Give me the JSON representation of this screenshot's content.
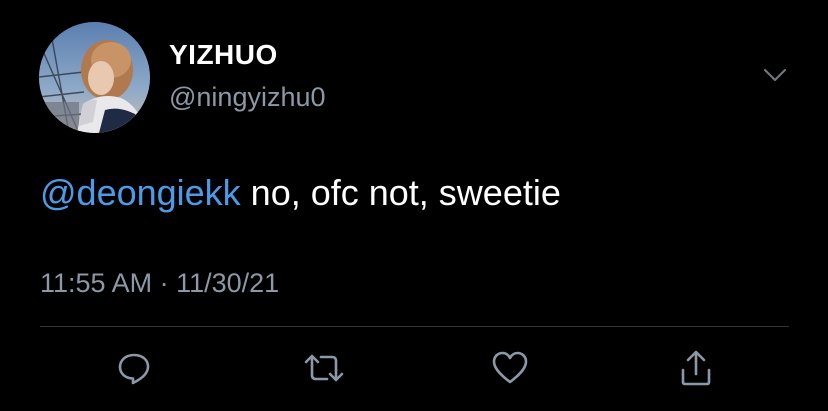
{
  "tweet": {
    "author": {
      "display_name": "YIZHUO",
      "handle": "@ningyizhu0",
      "avatar_icon": "profile-photo"
    },
    "text": {
      "mention": "@deongiekk",
      "body": " no, ofc not, sweetie"
    },
    "timestamp": "11:55 AM · 11/30/21",
    "actions": [
      {
        "name": "reply",
        "icon": "speech-bubble-icon"
      },
      {
        "name": "retweet",
        "icon": "retweet-arrows-icon"
      },
      {
        "name": "like",
        "icon": "heart-icon"
      },
      {
        "name": "share",
        "icon": "share-upload-icon"
      }
    ]
  },
  "colors": {
    "background": "#000000",
    "text": "#ffffff",
    "secondary": "#8b98a5",
    "mention": "#4c9be8",
    "divider": "#2f3336"
  }
}
